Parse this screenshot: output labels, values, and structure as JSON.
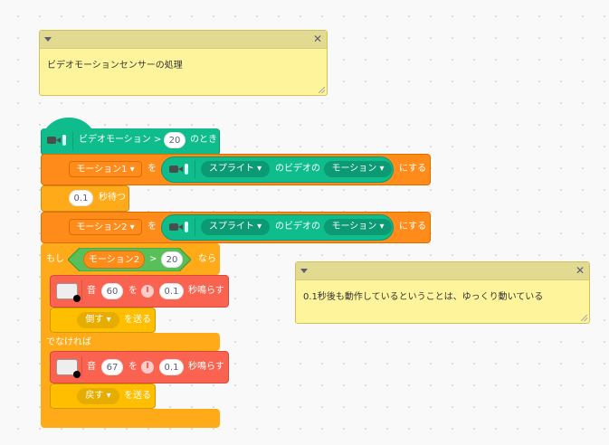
{
  "comments": [
    {
      "text": "ビデオモーションセンサーの処理",
      "collapse_icon": "triangle-down",
      "close_icon": "x"
    },
    {
      "text": "0.1秒後も動作しているということは、ゆっくり動いている",
      "collapse_icon": "triangle-down",
      "close_icon": "x"
    }
  ],
  "hat": {
    "label": "ビデオモーション >",
    "value": "20",
    "suffix": "のとき"
  },
  "set1": {
    "variable": "モーション1",
    "wo": "を",
    "target": "スプライト",
    "mid": "のビデオの",
    "attr": "モーション",
    "suffix": "にする"
  },
  "wait": {
    "value": "0.1",
    "label": "秒待つ"
  },
  "set2": {
    "variable": "モーション2",
    "wo": "を",
    "target": "スプライト",
    "mid": "のビデオの",
    "attr": "モーション",
    "suffix": "にする"
  },
  "if": {
    "label": "もし",
    "var": "モーション2",
    "op": ">",
    "value": "20",
    "then": "なら",
    "else": "でなければ"
  },
  "note1": {
    "label": "音",
    "note": "60",
    "wo": "を",
    "beats": "0.1",
    "suffix": "秒鳴らす"
  },
  "bc1": {
    "message": "倒す",
    "suffix": "を送る"
  },
  "note2": {
    "label": "音",
    "note": "67",
    "wo": "を",
    "beats": "0.1",
    "suffix": "秒鳴らす"
  },
  "bc2": {
    "message": "戻す",
    "suffix": "を送る"
  },
  "colors": {
    "video": "#0fbd8c",
    "variables": "#ff8c1a",
    "control": "#ffab19",
    "operators": "#59c059",
    "music": "#f9634f",
    "events": "#ffbf00",
    "comment": "#fef49c"
  }
}
